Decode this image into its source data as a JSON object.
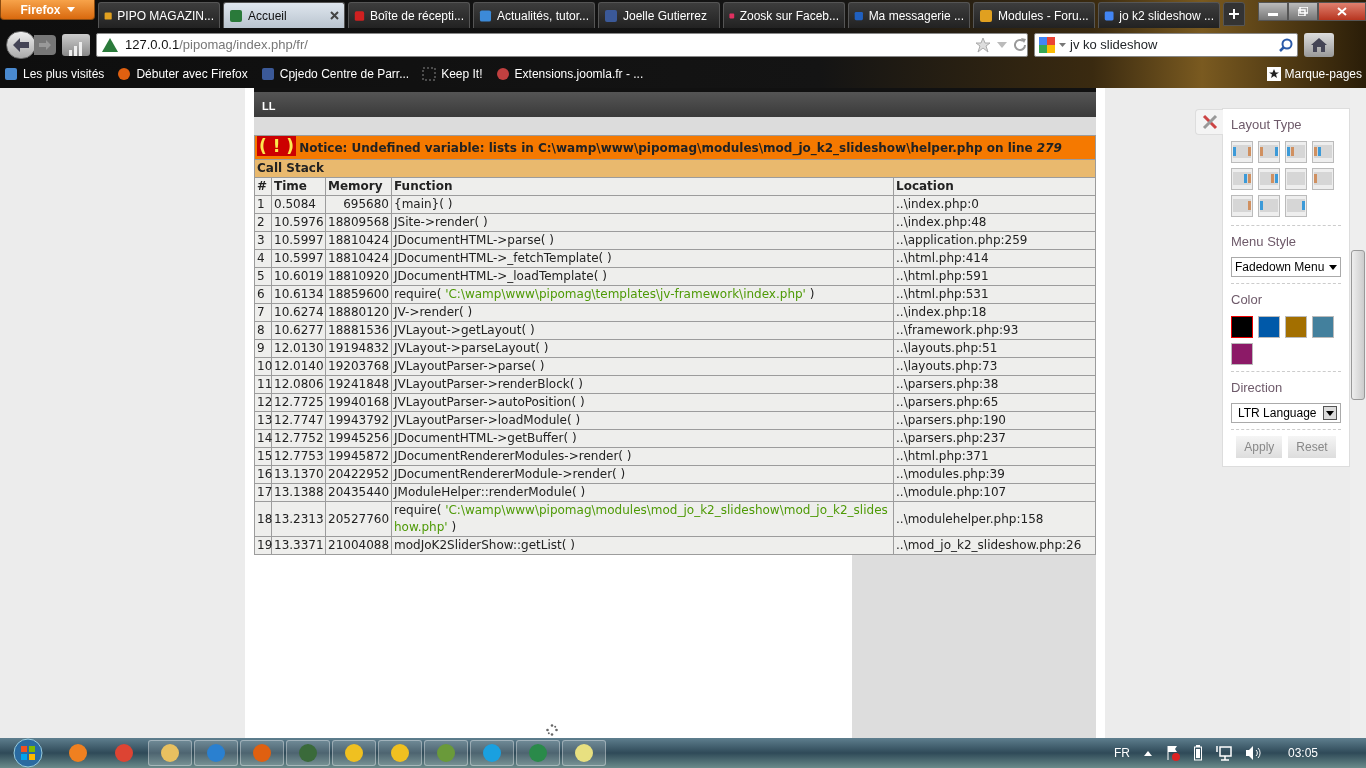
{
  "browser": {
    "menu_button": "Firefox",
    "tabs": [
      {
        "label": "PIPO MAGAZIN...",
        "selected": false
      },
      {
        "label": "Accueil",
        "selected": true
      },
      {
        "label": "Boîte de récepti...",
        "selected": false
      },
      {
        "label": "Actualités, tutor...",
        "selected": false
      },
      {
        "label": "Joelle Gutierrez",
        "selected": false
      },
      {
        "label": "Zoosk sur Faceb...",
        "selected": false
      },
      {
        "label": "Ma messagerie ...",
        "selected": false
      },
      {
        "label": "Modules - Foru...",
        "selected": false
      },
      {
        "label": "jo k2 slideshow ...",
        "selected": false
      }
    ],
    "address": {
      "host": "127.0.0.1",
      "path": "/pipomag/index.php/fr/"
    },
    "search": {
      "value": "jv ko slideshow"
    },
    "bookmarks": [
      "Les plus visités",
      "Débuter avec Firefox",
      "Cpjedo Centre de Parr...",
      "Keep It!",
      "Extensions.joomla.fr - ..."
    ],
    "bookmarks_menu": "Marque-pages"
  },
  "page": {
    "header_bar": "LL",
    "notice": {
      "icon_text": "( ! )",
      "message": "Notice: Undefined variable: lists in C:\\wamp\\www\\pipomag\\modules\\mod_jo_k2_slideshow\\helper.php on line *279*"
    },
    "call_stack": {
      "title": "Call Stack",
      "columns": [
        "#",
        "Time",
        "Memory",
        "Function",
        "Location"
      ],
      "rows": [
        {
          "n": "1",
          "time": "0.5084",
          "memory": "695680",
          "function": "{main}( )",
          "location": "..\\index.php:0"
        },
        {
          "n": "2",
          "time": "10.5976",
          "memory": "18809568",
          "function": "JSite->render( )",
          "location": "..\\index.php:48"
        },
        {
          "n": "3",
          "time": "10.5997",
          "memory": "18810424",
          "function": "JDocumentHTML->parse( )",
          "location": "..\\application.php:259"
        },
        {
          "n": "4",
          "time": "10.5997",
          "memory": "18810424",
          "function": "JDocumentHTML->_fetchTemplate( )",
          "location": "..\\html.php:414"
        },
        {
          "n": "5",
          "time": "10.6019",
          "memory": "18810920",
          "function": "JDocumentHTML->_loadTemplate( )",
          "location": "..\\html.php:591"
        },
        {
          "n": "6",
          "time": "10.6134",
          "memory": "18859600",
          "function": "require(",
          "argument": "'C:\\wamp\\www\\pipomag\\templates\\jv-framework\\index.php'",
          "function_end": ")",
          "location": "..\\html.php:531"
        },
        {
          "n": "7",
          "time": "10.6274",
          "memory": "18880120",
          "function": "JV->render( )",
          "location": "..\\index.php:18"
        },
        {
          "n": "8",
          "time": "10.6277",
          "memory": "18881536",
          "function": "JVLayout->getLayout( )",
          "location": "..\\framework.php:93"
        },
        {
          "n": "9",
          "time": "12.0130",
          "memory": "19194832",
          "function": "JVLayout->parseLayout( )",
          "location": "..\\layouts.php:51"
        },
        {
          "n": "10",
          "time": "12.0140",
          "memory": "19203768",
          "function": "JVLayoutParser->parse( )",
          "location": "..\\layouts.php:73"
        },
        {
          "n": "11",
          "time": "12.0806",
          "memory": "19241848",
          "function": "JVLayoutParser->renderBlock( )",
          "location": "..\\parsers.php:38"
        },
        {
          "n": "12",
          "time": "12.7725",
          "memory": "19940168",
          "function": "JVLayoutParser->autoPosition( )",
          "location": "..\\parsers.php:65"
        },
        {
          "n": "13",
          "time": "12.7747",
          "memory": "19943792",
          "function": "JVLayoutParser->loadModule( )",
          "location": "..\\parsers.php:190"
        },
        {
          "n": "14",
          "time": "12.7752",
          "memory": "19945256",
          "function": "JDocumentHTML->getBuffer( )",
          "location": "..\\parsers.php:237"
        },
        {
          "n": "15",
          "time": "12.7753",
          "memory": "19945872",
          "function": "JDocumentRendererModules->render( )",
          "location": "..\\html.php:371"
        },
        {
          "n": "16",
          "time": "13.1370",
          "memory": "20422952",
          "function": "JDocumentRendererModule->render( )",
          "location": "..\\modules.php:39"
        },
        {
          "n": "17",
          "time": "13.1388",
          "memory": "20435440",
          "function": "JModuleHelper::renderModule( )",
          "location": "..\\module.php:107"
        },
        {
          "n": "18",
          "time": "13.2313",
          "memory": "20527760",
          "function": "require(",
          "argument": "'C:\\wamp\\www\\pipomag\\modules\\mod_jo_k2_slideshow\\mod_jo_k2_slideshow.php'",
          "function_end": ")",
          "location": "..\\modulehelper.php:158"
        },
        {
          "n": "19",
          "time": "13.3371",
          "memory": "21004088",
          "function": "modJoK2SliderShow::getList( )",
          "location": "..\\mod_jo_k2_slideshow.php:26"
        }
      ]
    }
  },
  "settings_panel": {
    "layout_type": "Layout Type",
    "menu_style": {
      "label": "Menu Style",
      "value": "Fadedown Menu"
    },
    "color": {
      "label": "Color",
      "swatches": [
        {
          "color": "#000000",
          "selected": true
        },
        {
          "color": "#0059a9",
          "selected": false
        },
        {
          "color": "#a36f00",
          "selected": false
        },
        {
          "color": "#43809d",
          "selected": false
        },
        {
          "color": "#8c1a67",
          "selected": false
        }
      ]
    },
    "direction": {
      "label": "Direction",
      "value": "LTR Language"
    },
    "buttons": [
      "Apply",
      "Reset"
    ]
  },
  "taskbar": {
    "language": "FR",
    "time": "03:05"
  }
}
